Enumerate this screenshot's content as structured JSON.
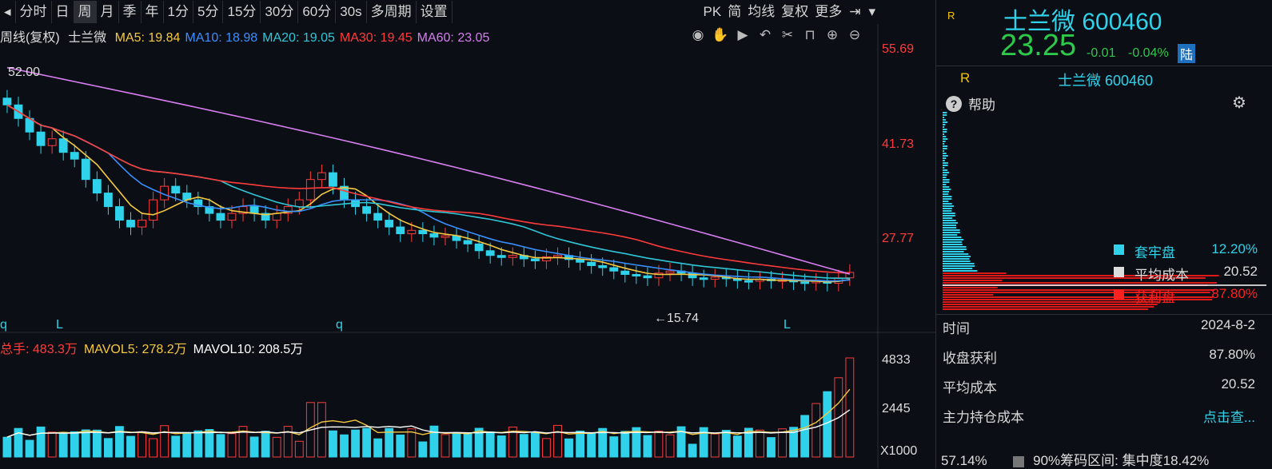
{
  "toolbar": {
    "items": [
      "分时",
      "日",
      "周",
      "月",
      "季",
      "年",
      "1分",
      "5分",
      "15分",
      "30分",
      "60分",
      "30s",
      "多周期",
      "设置"
    ],
    "active_index": 2,
    "right_items": [
      "PK",
      "简",
      "均线",
      "复权",
      "更多"
    ]
  },
  "legend": {
    "period": "周线(复权)",
    "stock": "士兰微",
    "ma": [
      {
        "label": "MA5: 19.84",
        "color": "#f5c842"
      },
      {
        "label": "MA10: 18.98",
        "color": "#3a8fff"
      },
      {
        "label": "MA20: 19.05",
        "color": "#2fc6d8"
      },
      {
        "label": "MA30: 19.45",
        "color": "#ff3b3b"
      },
      {
        "label": "MA60: 23.05",
        "color": "#d67ef0"
      }
    ]
  },
  "price_axis": [
    "55.69",
    "41.73",
    "27.77"
  ],
  "annotations": {
    "high": "52.00",
    "low": "←15.74",
    "markers": [
      "q",
      "L",
      "q",
      "L"
    ]
  },
  "volume_legend": [
    {
      "label": "总手: 483.3万",
      "color": "#ff3b3b"
    },
    {
      "label": "MAVOL5: 278.2万",
      "color": "#f5c842"
    },
    {
      "label": "MAVOL10: 208.5万",
      "color": "#ffffff"
    }
  ],
  "volume_axis": [
    "4833",
    "2445",
    "X1000"
  ],
  "chart_data": {
    "type": "candlestick",
    "closes": [
      48,
      46,
      44,
      42,
      43,
      41,
      40,
      37,
      35,
      33,
      31,
      30,
      31,
      34,
      36,
      35,
      34,
      33,
      32,
      31,
      32,
      33,
      32,
      31,
      32,
      33,
      34,
      37,
      38,
      36,
      34,
      33,
      32,
      31,
      30,
      29,
      29.5,
      29,
      28.5,
      28.7,
      28,
      27.5,
      26.5,
      25.8,
      25.5,
      25.8,
      25.3,
      25,
      25.6,
      25.8,
      25.2,
      24.8,
      24.3,
      24,
      23.5,
      23,
      22.8,
      22.5,
      23.2,
      23.5,
      23.2,
      22.5,
      22.3,
      22.6,
      22.4,
      22.1,
      22,
      22.3,
      22.1,
      22.2,
      21.9,
      21.8,
      22,
      21.7,
      22.5,
      23.3
    ],
    "ma60_start": 53.5,
    "ma60_end": 23.05
  },
  "right_panel": {
    "title": "士兰微 600460",
    "price": "23.25",
    "change": "-0.01",
    "pct": "-0.04%",
    "lu": "陆",
    "r_label": "R",
    "sub_title": "士兰微 600460",
    "help": "帮助",
    "legend": [
      {
        "name": "套牢盘",
        "pct": "12.20%",
        "color": "#2fd2ea"
      },
      {
        "name": "平均成本",
        "pct": "20.52",
        "color": "#dddddd"
      },
      {
        "name": "获利盘",
        "pct": "87.80%",
        "color": "#ff2020"
      }
    ],
    "stats": [
      {
        "label": "时间",
        "value": "2024-8-2"
      },
      {
        "label": "收盘获利",
        "value": "87.80%"
      },
      {
        "label": "平均成本",
        "value": "20.52"
      },
      {
        "label": "主力持仓成本",
        "value": "点击查..."
      }
    ],
    "bottom_left": "57.14%",
    "bottom_right": "90%筹码区间: 集中度18.42%"
  }
}
